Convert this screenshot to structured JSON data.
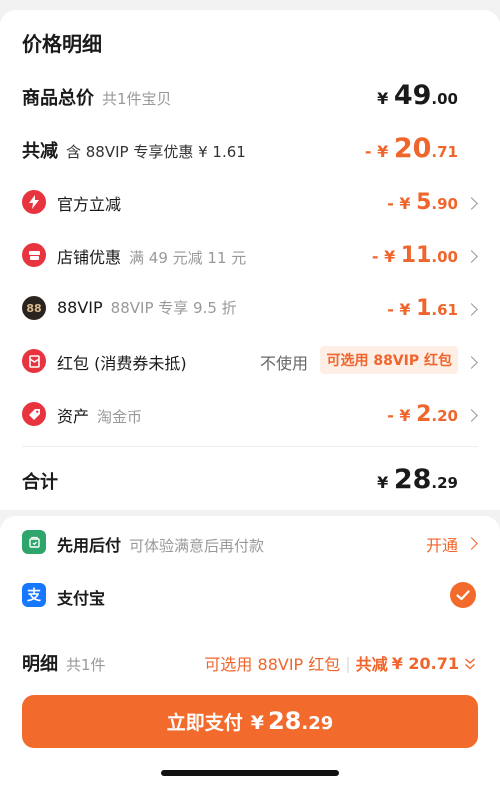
{
  "section_title": "价格明细",
  "goods_total": {
    "label": "商品总价",
    "sub": "共1件宝贝",
    "currency": "¥",
    "int": "49",
    "dec": ".00"
  },
  "total_reduce": {
    "label": "共减",
    "sub": "含 88VIP 专享优惠 ¥ 1.61",
    "prefix": "- ¥",
    "int": "20",
    "dec": ".71"
  },
  "items": [
    {
      "label": "官方立减",
      "sub": "",
      "prefix": "- ¥",
      "int": "5",
      "dec": ".90"
    },
    {
      "label": "店铺优惠",
      "sub": "满 49 元减 11 元",
      "prefix": "- ¥",
      "int": "11",
      "dec": ".00"
    },
    {
      "label": "88VIP",
      "sub": "88VIP 专享 9.5 折",
      "prefix": "- ¥",
      "int": "1",
      "dec": ".61",
      "badge": "88"
    },
    {
      "label": "红包 (消费券未抵)",
      "sub": "",
      "nouse": "不使用",
      "tag": "可选用 88VIP 红包"
    },
    {
      "label": "资产",
      "sub": "淘金币",
      "prefix": "- ¥",
      "int": "2",
      "dec": ".20"
    }
  ],
  "sum": {
    "label": "合计",
    "currency": "¥",
    "int": "28",
    "dec": ".29"
  },
  "xianyong": {
    "label": "先用后付",
    "sub": "可体验满意后再付款",
    "action": "开通"
  },
  "alipay": {
    "label": "支付宝"
  },
  "detail": {
    "label": "明细",
    "sub": "共1件",
    "redpacket": "可选用 88VIP 红包",
    "sep": "|",
    "reduce_label": "共减",
    "reduce_value": "¥ 20.71"
  },
  "pay_button": {
    "label": "立即支付",
    "currency": "¥",
    "int": "28",
    "dec": ".29"
  },
  "colors": {
    "accent": "#f26b2c",
    "text": "#1a1a1a",
    "muted": "#999999",
    "divider": "#eeeeee"
  }
}
